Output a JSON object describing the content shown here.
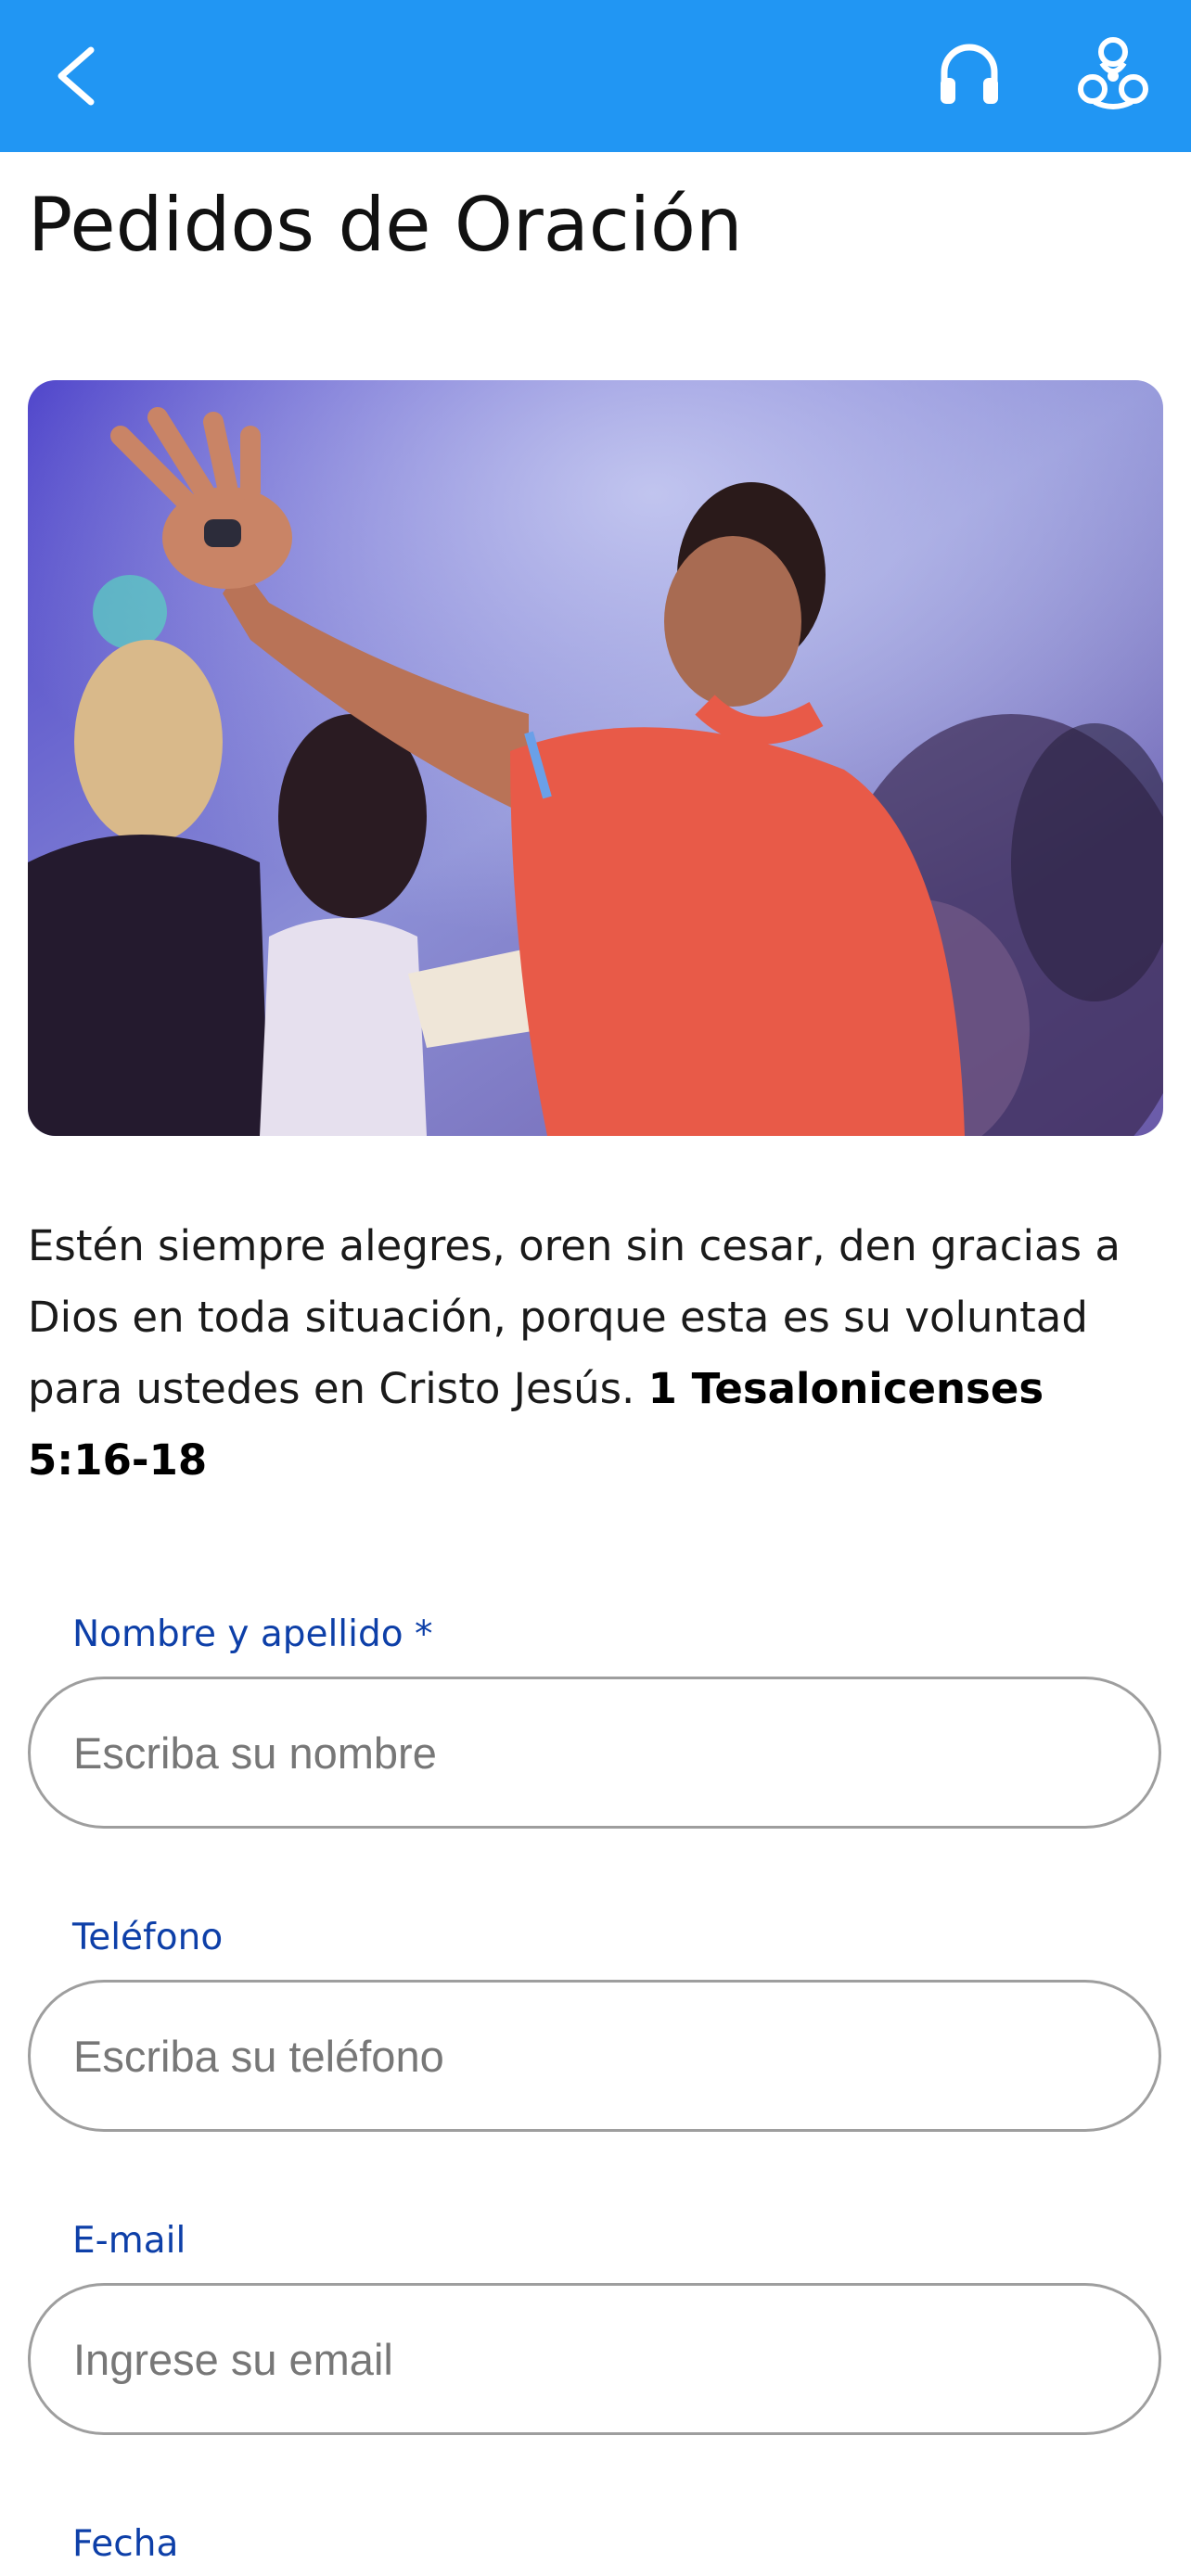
{
  "header": {
    "back_icon": "chevron-left-icon",
    "audio_icon": "headphones-icon",
    "logo_icon": "ministry-logo-icon",
    "background": "#2196f3"
  },
  "page": {
    "title": "Pedidos de Oración"
  },
  "hero_image": {
    "description_icon": "worship-photo"
  },
  "verse": {
    "text": "Estén siempre alegres, oren sin cesar, den gracias a Dios en toda situación, porque esta es su voluntad para ustedes en Cristo Jesús. ",
    "reference": "1 Tesalonicenses 5:16-18"
  },
  "form": {
    "name_label": "Nombre y apellido *",
    "name_placeholder": "Escriba su nombre",
    "phone_label": "Teléfono",
    "phone_placeholder": "Escriba su teléfono",
    "email_label": "E-mail",
    "email_placeholder": "Ingrese su email",
    "date_label": "Fecha"
  },
  "colors": {
    "accent": "#2196f3",
    "label": "#0d3fa8"
  }
}
